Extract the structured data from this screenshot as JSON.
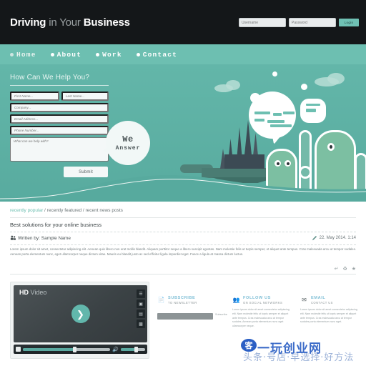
{
  "header": {
    "logo_part1": "Driving",
    "logo_part2": " in Your ",
    "logo_part3": "Business",
    "username_placeholder": "Username",
    "password_placeholder": "Password",
    "login_label": "Login"
  },
  "nav": {
    "items": [
      {
        "label": "Home",
        "active": false
      },
      {
        "label": "About",
        "active": true
      },
      {
        "label": "Work",
        "active": true
      },
      {
        "label": "Contact",
        "active": true
      }
    ]
  },
  "hero": {
    "form_title": "How Can We Help You?",
    "fields": {
      "first_name": "First Name...",
      "last_name": "Last Name...",
      "company": "Company...",
      "email": "Email Address...",
      "phone": "Phone Number...",
      "message": "What can we help with?"
    },
    "submit_label": "Submit",
    "bubble_line1": "We",
    "bubble_line2": "Answer"
  },
  "article": {
    "breadcrumb_active": "recently popular",
    "breadcrumb_rest": " / recently featured / recent news posts",
    "title": "Best solutions for your online business",
    "byline": "Written by: Sample Name",
    "date": "22. May 2014.  1:14",
    "body": "Lorem ipsum dolor sit amet, consectetur adipiscing elit. Aenean quis libero non erat mollis blandit. Aliquam porttitor neque a libero suscipit egestas. Nam molestie felis ut turpis semper, et aliquet ante tempus. Cras malesuada arcu ut tempor sodales. Aenean porta elementum nunc, eget ullamcorper neque dictum vitae. Mauris eu blandit justo ac sed efficitur ligula imperdiet eget. Fusce a ligula at massa dictum luctus.",
    "icons": [
      "reply-icon",
      "recycle-icon",
      "star-icon"
    ]
  },
  "video": {
    "hd_label": "HD",
    "title": "Video",
    "play_icon": "play-icon",
    "side_buttons": [
      "playlist-icon",
      "screen-icon",
      "equalizer-icon",
      "signal-icon"
    ]
  },
  "columns": [
    {
      "icon": "newsletter-icon",
      "title": "SUBSCRIBE",
      "subtitle": "TO NEWSLETTER",
      "input_label": "Subscribe",
      "text": ""
    },
    {
      "icon": "people-icon",
      "title": "FOLLOW US",
      "subtitle": "ON SOCIAL NETWORKS",
      "text": "Lorem ipsum dolor sit amet consectetur adipiscing elit. Nam molestie felis ut turpis semper et aliquet ante tempus. Cras malesuada arcu at tempor sodales. Aenean porta elementum nunc eget ullamcorper neque."
    },
    {
      "icon": "envelope-icon",
      "title": "EMAIL",
      "subtitle": "CONTACT US",
      "text": "Lorem ipsum dolor sit amet consectetur adipiscing elit. Nam molestie felis ut turpis semper et aliquet ante tempus. Cras malesuada arcu at tempor sodales porta elementum nunc eget."
    }
  ],
  "watermark": {
    "mark": "客",
    "text": "一玩创业网",
    "sub": "头条·号店·早选择·好方法"
  },
  "colors": {
    "dark": "#141719",
    "teal": "#6dbfb1",
    "hero": "#5fb3a6",
    "accent_blue": "#7fbfd6"
  }
}
